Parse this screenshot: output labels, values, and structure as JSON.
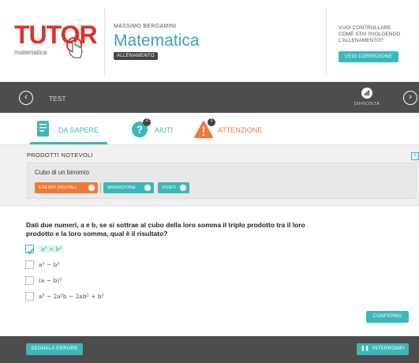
{
  "header": {
    "logo_text": "TUTOR",
    "logo_sub": "matematica",
    "author": "MASSIMO BERGAMINI",
    "subject": "Matematica",
    "mode": "ALLENAMENTO",
    "prompt_lines": [
      "VUOI CONTROLLARE",
      "COME STAI SVOLGENDO",
      "L'ALLENAMENTO?"
    ],
    "correction_button": "VEDI CORREZIONE",
    "brand_color": "#d9342b",
    "accent_color": "#3ab8bb"
  },
  "topbar": {
    "prev_icon": "chevron-left-icon",
    "next_icon": "chevron-right-icon",
    "title": "TEST",
    "difficulty_label": "DIFFICOLTÀ"
  },
  "tabs": [
    {
      "label": "DA SAPERE",
      "icon": "book-icon",
      "badge": "",
      "color": "#3ab8bb"
    },
    {
      "label": "AIUTI",
      "icon": "question-icon",
      "badge": "2",
      "color": "#3ab8bb"
    },
    {
      "label": "ATTENZIONE",
      "icon": "warning-icon",
      "badge": "1",
      "color": "#f0793a"
    }
  ],
  "section": {
    "title": "PRODOTTI NOTEVOLI",
    "topic": "Cubo di un binomio",
    "buttons": [
      {
        "label": "ESEMPI DIGITALI",
        "color": "#f0793a"
      },
      {
        "label": "ANIMAZIONE",
        "color": "#3ab8bb"
      },
      {
        "label": "VIDEO",
        "color": "#3ab8bb"
      }
    ]
  },
  "question": {
    "text": "Dati due numeri, a e b, se si sottrae al cubo della loro somma il triplo prodotto tra il loro prodotto e la loro somma, qual è il risultato?",
    "options": [
      {
        "text": "a³ + b³",
        "checked": true
      },
      {
        "text": "a³ − b³",
        "checked": false
      },
      {
        "text": "(a − b)³",
        "checked": false
      },
      {
        "text": "a³ − 2a²b − 2ab² + b³",
        "checked": false
      }
    ],
    "confirm_button": "CONFERMA"
  },
  "footer": {
    "report_button": "SEGNALA ERRORE",
    "stop_button": "INTERROMPI"
  }
}
